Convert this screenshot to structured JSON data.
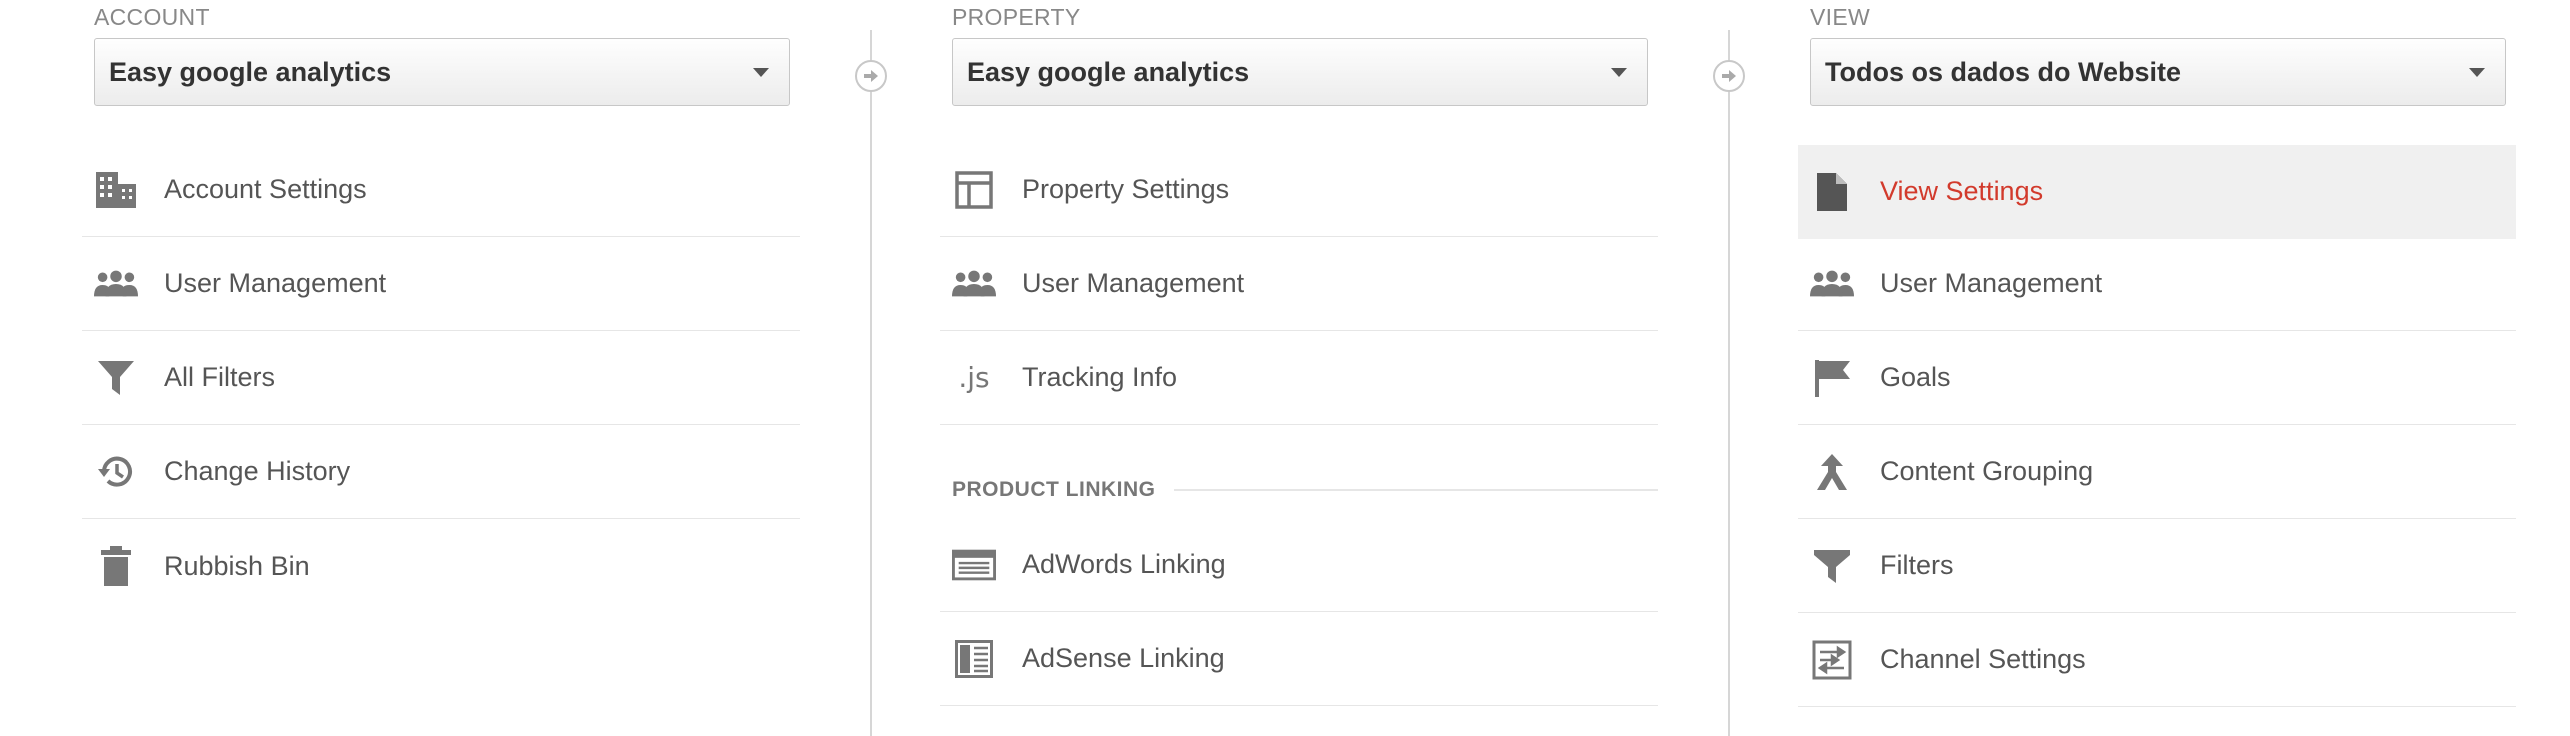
{
  "account": {
    "label": "ACCOUNT",
    "selected": "Easy google analytics",
    "items": [
      {
        "label": "Account Settings",
        "icon": "building-icon"
      },
      {
        "label": "User Management",
        "icon": "users-icon"
      },
      {
        "label": "All Filters",
        "icon": "filter-icon"
      },
      {
        "label": "Change History",
        "icon": "history-icon"
      },
      {
        "label": "Rubbish Bin",
        "icon": "trash-icon"
      }
    ]
  },
  "property": {
    "label": "PROPERTY",
    "selected": "Easy google analytics",
    "items": [
      {
        "label": "Property Settings",
        "icon": "layout-icon"
      },
      {
        "label": "User Management",
        "icon": "users-icon"
      },
      {
        "label": "Tracking Info",
        "icon": "js-icon",
        "icon_text": ".js"
      }
    ],
    "section_heading": "PRODUCT LINKING",
    "linking_items": [
      {
        "label": "AdWords Linking",
        "icon": "adwords-icon"
      },
      {
        "label": "AdSense Linking",
        "icon": "adsense-icon"
      }
    ]
  },
  "view": {
    "label": "VIEW",
    "selected": "Todos os dados do Website",
    "active_color": "#d23a2c",
    "items": [
      {
        "label": "View Settings",
        "icon": "document-icon",
        "active": true
      },
      {
        "label": "User Management",
        "icon": "users-icon"
      },
      {
        "label": "Goals",
        "icon": "flag-icon"
      },
      {
        "label": "Content Grouping",
        "icon": "content-grouping-icon"
      },
      {
        "label": "Filters",
        "icon": "filter-icon"
      },
      {
        "label": "Channel Settings",
        "icon": "channel-settings-icon"
      }
    ]
  }
}
